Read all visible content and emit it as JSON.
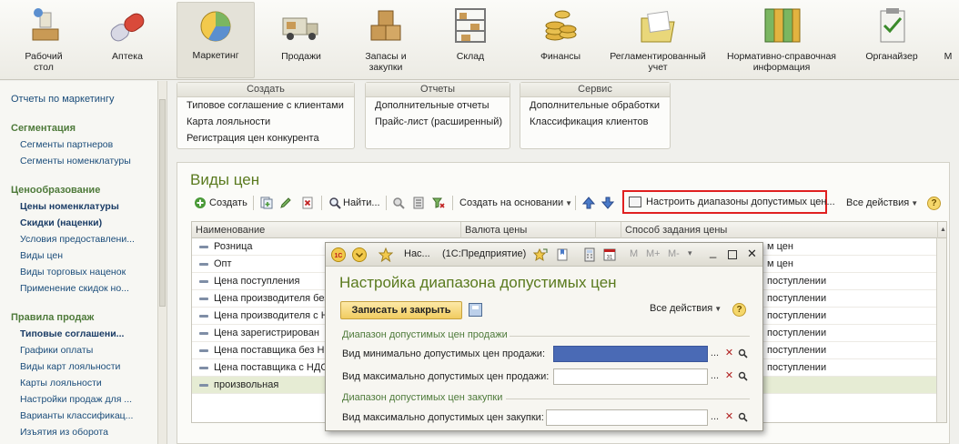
{
  "sections": [
    {
      "label": "Рабочий\nстол",
      "icon": "desk-icon"
    },
    {
      "label": "Аптека",
      "icon": "pill-icon"
    },
    {
      "label": "Маркетинг",
      "icon": "pie-chart-icon"
    },
    {
      "label": "Продажи",
      "icon": "truck-icon"
    },
    {
      "label": "Запасы и\nзакупки",
      "icon": "boxes-icon"
    },
    {
      "label": "Склад",
      "icon": "shelves-icon"
    },
    {
      "label": "Финансы",
      "icon": "coins-icon"
    },
    {
      "label": "Регламентированный\nучет",
      "icon": "folder-icon"
    },
    {
      "label": "Нормативно-справочная\nинформация",
      "icon": "binders-icon"
    },
    {
      "label": "Органайзер",
      "icon": "clipboard-icon"
    },
    {
      "label": "М",
      "icon": "more-icon"
    }
  ],
  "leftnav": {
    "reports_link": "Отчеты по маркетингу",
    "groups": [
      {
        "title": "Сегментация",
        "items": [
          "Сегменты партнеров",
          "Сегменты номенклатуры"
        ]
      },
      {
        "title": "Ценообразование",
        "items": [
          "Цены номенклатуры",
          "Скидки (наценки)",
          "Условия предоставлени...",
          "Виды цен",
          "Виды торговых наценок",
          "Применение скидок но..."
        ]
      },
      {
        "title": "Правила продаж",
        "items": [
          "Типовые соглашени...",
          "Графики оплаты",
          "Виды карт лояльности",
          "Карты лояльности",
          "Настройки продаж для ...",
          "Варианты классификац...",
          "Изъятия из оборота"
        ]
      }
    ]
  },
  "command_groups": {
    "create": {
      "title": "Создать",
      "items": [
        "Типовое соглашение с клиентами",
        "Карта лояльности",
        "Регистрация цен конкурента"
      ]
    },
    "reports": {
      "title": "Отчеты",
      "items": [
        "Дополнительные отчеты",
        "Прайс-лист (расширенный)"
      ]
    },
    "service": {
      "title": "Сервис",
      "items": [
        "Дополнительные обработки",
        "Классификация клиентов"
      ]
    }
  },
  "form": {
    "title": "Виды цен",
    "toolbar": {
      "create": "Создать",
      "find": "Найти...",
      "create_based": "Создать на основании",
      "configure_ranges": "Настроить диапазоны допустимых цен...",
      "all_actions": "Все действия",
      "help": "?"
    },
    "columns": [
      "Наименование",
      "Валюта цены",
      "Способ задания цены"
    ],
    "rows": [
      {
        "name": "Розница",
        "mode": "м цен"
      },
      {
        "name": "Опт",
        "mode": "м цен"
      },
      {
        "name": "Цена поступления",
        "mode": "поступлении"
      },
      {
        "name": "Цена производителя без",
        "mode": "поступлении"
      },
      {
        "name": "Цена производителя с Н",
        "mode": "поступлении"
      },
      {
        "name": "Цена зарегистрирован",
        "mode": "поступлении"
      },
      {
        "name": "Цена поставщика без Н",
        "mode": "поступлении"
      },
      {
        "name": "Цена поставщика с НДС",
        "mode": "поступлении"
      },
      {
        "name": "произвольная",
        "mode": ""
      }
    ]
  },
  "modal": {
    "window_title": "Нас...",
    "app_title": "(1С:Предприятие)",
    "mem_labels": [
      "M",
      "M+",
      "M-"
    ],
    "heading": "Настройка диапазона допустимых цен",
    "save_close": "Записать и закрыть",
    "all_actions": "Все действия",
    "help": "?",
    "sale_group": "Диапазон допустимых цен продажи",
    "sale_min_label": "Вид минимально допустимых цен продажи:",
    "sale_max_label": "Вид максимально допустимых цен продажи:",
    "purchase_group": "Диапазон допустимых цен закупки",
    "purchase_max_label": "Вид максимально допустимых цен закупки:",
    "dots": "...",
    "clear": "✕",
    "search": "🔍"
  }
}
